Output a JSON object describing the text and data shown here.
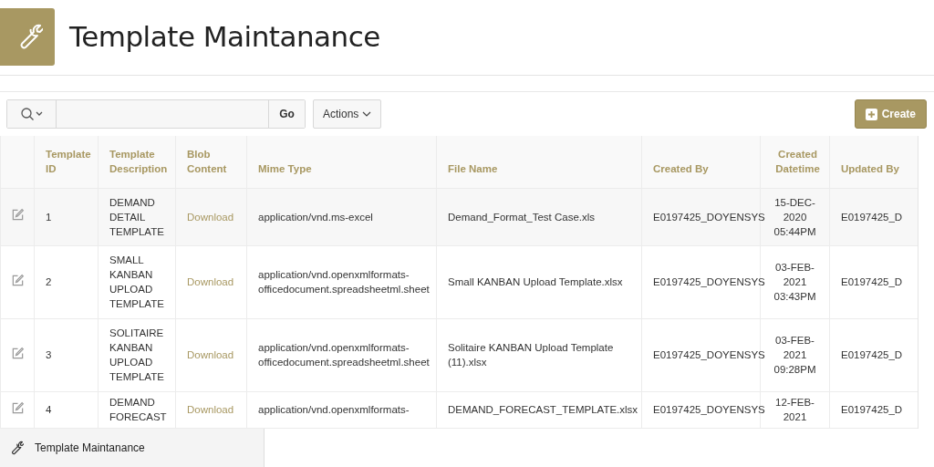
{
  "page": {
    "title": "Template Maintanance"
  },
  "toolbar": {
    "go": "Go",
    "actions": "Actions",
    "create": "Create"
  },
  "table": {
    "columns": [
      "Template ID",
      "Template Description",
      "Blob Content",
      "Mime Type",
      "File Name",
      "Created By",
      "Created Datetime",
      "Updated By"
    ],
    "rows": [
      {
        "id": "1",
        "description": "DEMAND DETAIL TEMPLATE",
        "blob": "Download",
        "mime": "application/vnd.ms-excel",
        "file": "Demand_Format_Test Case.xls",
        "created_by": "E0197425_DOYENSYS",
        "created": "15-DEC-2020 05:44PM",
        "updated_by": "E0197425_D",
        "selected": true
      },
      {
        "id": "2",
        "description": "SMALL KANBAN UPLOAD TEMPLATE",
        "blob": "Download",
        "mime": "application/vnd.openxmlformats-officedocument.spreadsheetml.sheet",
        "file": "Small KANBAN Upload Template.xlsx",
        "created_by": "E0197425_DOYENSYS",
        "created": "03-FEB-2021 03:43PM",
        "updated_by": "E0197425_D",
        "selected": false
      },
      {
        "id": "3",
        "description": "SOLITAIRE KANBAN UPLOAD TEMPLATE",
        "blob": "Download",
        "mime": "application/vnd.openxmlformats-officedocument.spreadsheetml.sheet",
        "file": "Solitaire KANBAN Upload Template (11).xlsx",
        "created_by": "E0197425_DOYENSYS",
        "created": "03-FEB-2021 09:28PM",
        "updated_by": "E0197425_D",
        "selected": false
      },
      {
        "id": "4",
        "description": "DEMAND FORECAST",
        "blob": "Download",
        "mime": "application/vnd.openxmlformats-",
        "file": "DEMAND_FORECAST_TEMPLATE.xlsx",
        "created_by": "E0197425_DOYENSYS",
        "created": "12-FEB-2021",
        "updated_by": "E0197425_D",
        "selected": false
      }
    ]
  },
  "bottom_bar": {
    "label": "Template Maintanance"
  }
}
